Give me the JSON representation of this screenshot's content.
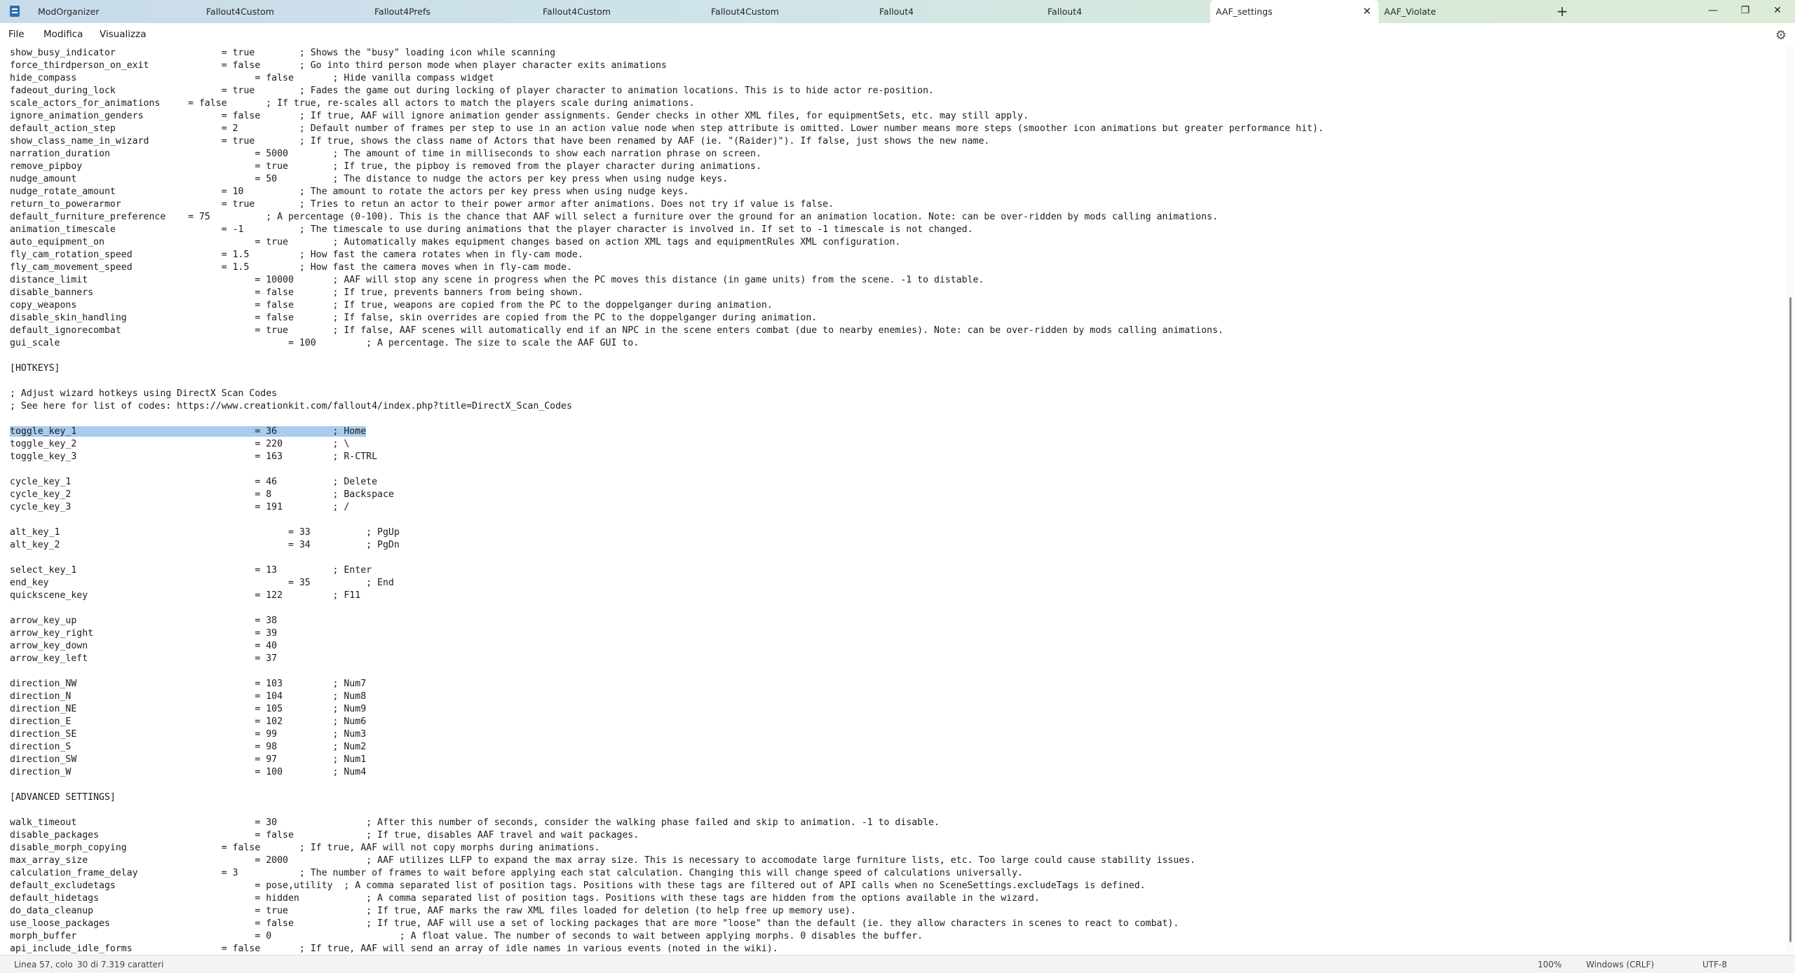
{
  "tabs": [
    {
      "label": "ModOrganizer"
    },
    {
      "label": "Fallout4Custom"
    },
    {
      "label": "Fallout4Prefs"
    },
    {
      "label": "Fallout4Custom"
    },
    {
      "label": "Fallout4Custom"
    },
    {
      "label": "Fallout4"
    },
    {
      "label": "Fallout4"
    },
    {
      "label": "AAF_settings",
      "active": true
    },
    {
      "label": "AAF_Violate"
    }
  ],
  "tab_close_glyph": "✕",
  "new_tab_glyph": "+",
  "window_controls": {
    "minimize": "—",
    "maximize": "❐",
    "close": "✕"
  },
  "menu": {
    "file": "File",
    "edit": "Modifica",
    "view": "Visualizza"
  },
  "settings_glyph": "⚙",
  "editor_lines": [
    "show_busy_indicator                   = true        ; Shows the \"busy\" loading icon while scanning",
    "force_thirdperson_on_exit             = false       ; Go into third person mode when player character exits animations",
    "hide_compass                                = false       ; Hide vanilla compass widget",
    "fadeout_during_lock                   = true        ; Fades the game out during locking of player character to animation locations. This is to hide actor re-position.",
    "scale_actors_for_animations     = false       ; If true, re-scales all actors to match the players scale during animations.",
    "ignore_animation_genders              = false       ; If true, AAF will ignore animation gender assignments. Gender checks in other XML files, for equipmentSets, etc. may still apply.",
    "default_action_step                   = 2           ; Default number of frames per step to use in an action value node when step attribute is omitted. Lower number means more steps (smoother icon animations but greater performance hit).",
    "show_class_name_in_wizard             = true        ; If true, shows the class name of Actors that have been renamed by AAF (ie. \"(Raider)\"). If false, just shows the new name.",
    "narration_duration                          = 5000        ; The amount of time in milliseconds to show each narration phrase on screen.",
    "remove_pipboy                               = true        ; If true, the pipboy is removed from the player character during animations.",
    "nudge_amount                                = 50          ; The distance to nudge the actors per key press when using nudge keys.",
    "nudge_rotate_amount                   = 10          ; The amount to rotate the actors per key press when using nudge keys.",
    "return_to_powerarmor                  = true        ; Tries to retun an actor to their power armor after animations. Does not try if value is false.",
    "default_furniture_preference    = 75          ; A percentage (0-100). This is the chance that AAF will select a furniture over the ground for an animation location. Note: can be over-ridden by mods calling animations.",
    "animation_timescale                   = -1          ; The timescale to use during animations that the player character is involved in. If set to -1 timescale is not changed.",
    "auto_equipment_on                           = true        ; Automatically makes equipment changes based on action XML tags and equipmentRules XML configuration.",
    "fly_cam_rotation_speed                = 1.5         ; How fast the camera rotates when in fly-cam mode.",
    "fly_cam_movement_speed                = 1.5         ; How fast the camera moves when in fly-cam mode.",
    "distance_limit                              = 10000       ; AAF will stop any scene in progress when the PC moves this distance (in game units) from the scene. -1 to distable.",
    "disable_banners                             = false       ; If true, prevents banners from being shown.",
    "copy_weapons                                = false       ; If true, weapons are copied from the PC to the doppelganger during animation.",
    "disable_skin_handling                       = false       ; If false, skin overrides are copied from the PC to the doppelganger during animation.",
    "default_ignorecombat                        = true        ; If false, AAF scenes will automatically end if an NPC in the scene enters combat (due to nearby enemies). Note: can be over-ridden by mods calling animations.",
    "gui_scale                                         = 100         ; A percentage. The size to scale the AAF GUI to.",
    "",
    "[HOTKEYS]",
    "",
    "; Adjust wizard hotkeys using DirectX Scan Codes",
    "; See here for list of codes: https://www.creationkit.com/fallout4/index.php?title=DirectX_Scan_Codes",
    "",
    "toggle_key_1                                = 36          ; Home",
    "toggle_key_2                                = 220         ; \\",
    "toggle_key_3                                = 163         ; R-CTRL",
    "",
    "cycle_key_1                                 = 46          ; Delete",
    "cycle_key_2                                 = 8           ; Backspace",
    "cycle_key_3                                 = 191         ; /",
    "",
    "alt_key_1                                         = 33          ; PgUp",
    "alt_key_2                                         = 34          ; PgDn",
    "",
    "select_key_1                                = 13          ; Enter",
    "end_key                                           = 35          ; End",
    "quickscene_key                              = 122         ; F11",
    "",
    "arrow_key_up                                = 38",
    "arrow_key_right                             = 39",
    "arrow_key_down                              = 40",
    "arrow_key_left                              = 37",
    "",
    "direction_NW                                = 103         ; Num7",
    "direction_N                                 = 104         ; Num8",
    "direction_NE                                = 105         ; Num9",
    "direction_E                                 = 102         ; Num6",
    "direction_SE                                = 99          ; Num3",
    "direction_S                                 = 98          ; Num2",
    "direction_SW                                = 97          ; Num1",
    "direction_W                                 = 100         ; Num4",
    "",
    "[ADVANCED SETTINGS]",
    "",
    "walk_timeout                                = 30                ; After this number of seconds, consider the walking phase failed and skip to animation. -1 to disable.",
    "disable_packages                            = false             ; If true, disables AAF travel and wait packages.",
    "disable_morph_copying                 = false       ; If true, AAF will not copy morphs during animations.",
    "max_array_size                              = 2000              ; AAF utilizes LLFP to expand the max array size. This is necessary to accomodate large furniture lists, etc. Too large could cause stability issues.",
    "calculation_frame_delay               = 3           ; The number of frames to wait before applying each stat calculation. Changing this will change speed of calculations universally.",
    "default_excludetags                         = pose,utility  ; A comma separated list of position tags. Positions with these tags are filtered out of API calls when no SceneSettings.excludeTags is defined.",
    "default_hidetags                            = hidden            ; A comma separated list of position tags. Positions with these tags are hidden from the options available in the wizard.",
    "do_data_cleanup                             = true              ; If true, AAF marks the raw XML files loaded for deletion (to help free up memory use).",
    "use_loose_packages                          = false             ; If true, AAF will use a set of locking packages that are more \"loose\" than the default (ie. they allow characters in scenes to react to combat).",
    "morph_buffer                                = 0                       ; A float value. The number of seconds to wait between applying morphs. 0 disables the buffer.",
    "api_include_idle_forms                = false       ; If true, AAF will send an array of idle names in various events (noted in the wiki)."
  ],
  "highlight_line": 30,
  "status": {
    "position": "Linea 57, colo",
    "selection": "30 di 7.319 caratteri",
    "zoom": "100%",
    "line_ending": "Windows (CRLF)",
    "encoding": "UTF-8"
  }
}
